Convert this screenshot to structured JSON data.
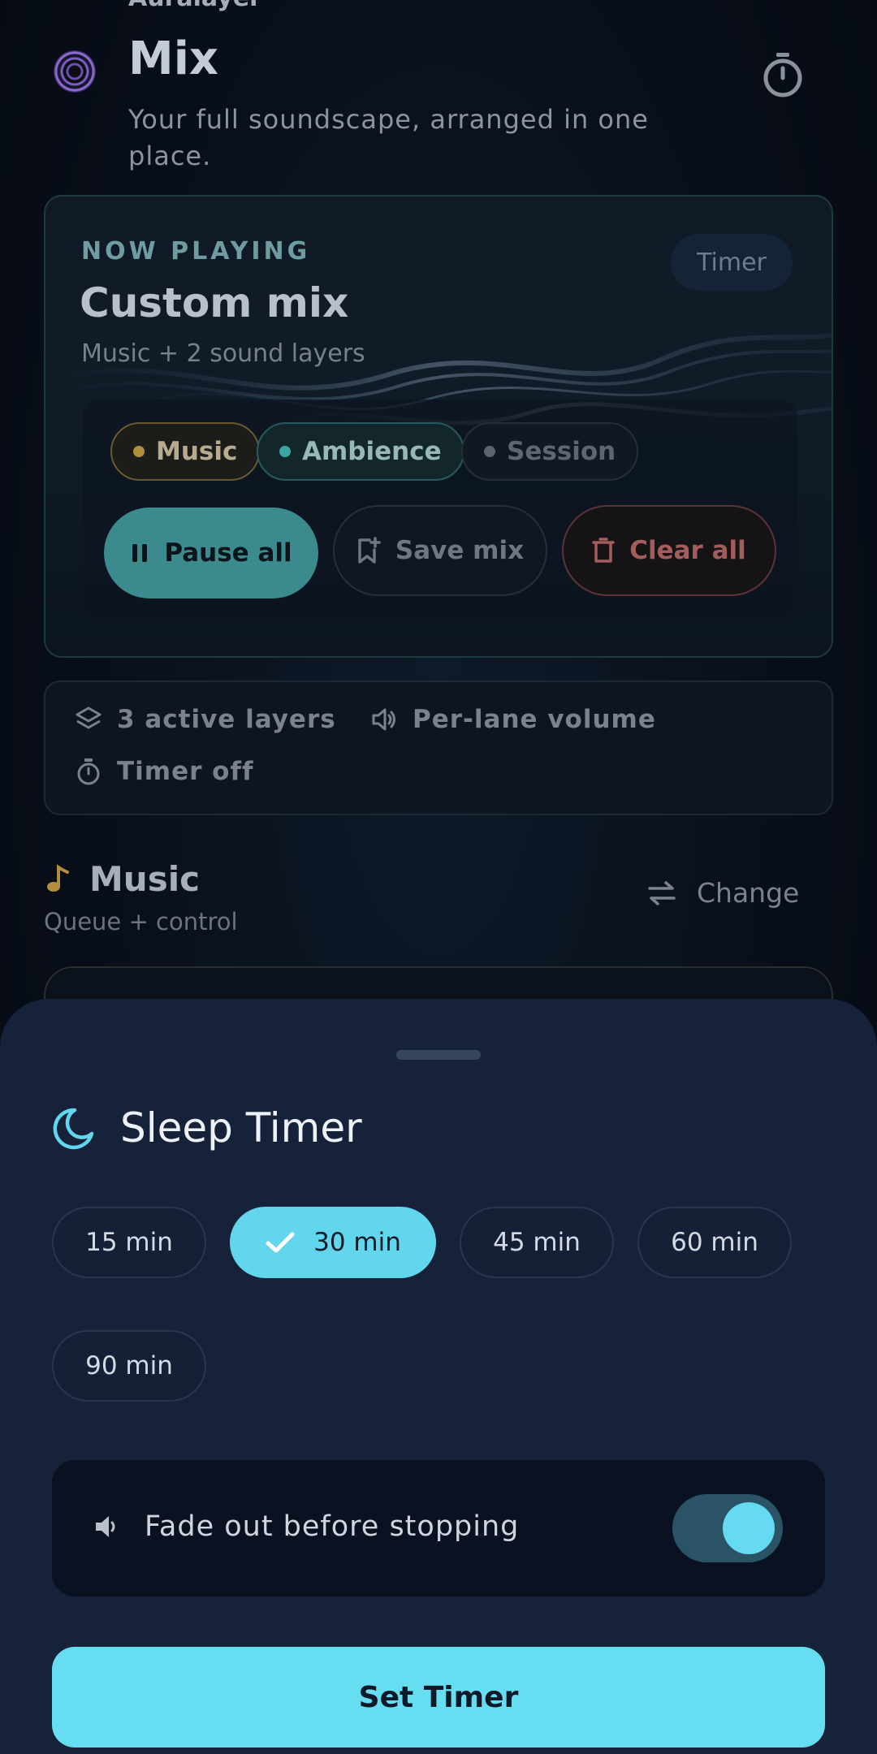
{
  "header": {
    "app_name": "Auralayer",
    "title": "Mix",
    "subtitle": "Your full soundscape, arranged in one place."
  },
  "now_playing": {
    "label": "NOW PLAYING",
    "title": "Custom mix",
    "subtitle": "Music + 2 sound layers",
    "timer_pill": "Timer",
    "chips": [
      {
        "label": "Music",
        "color": "#b08e3e"
      },
      {
        "label": "Ambience",
        "color": "#3fa4a2"
      },
      {
        "label": "Session",
        "color": "#5a6470"
      }
    ],
    "actions": {
      "pause": "Pause all",
      "save": "Save mix",
      "clear": "Clear all"
    }
  },
  "stats": {
    "layers": "3 active layers",
    "volume": "Per-lane volume",
    "timer": "Timer off"
  },
  "music_section": {
    "title": "Music",
    "subtitle": "Queue + control",
    "change": "Change"
  },
  "sleep_sheet": {
    "title": "Sleep Timer",
    "durations": [
      "15 min",
      "30 min",
      "45 min",
      "60 min",
      "90 min"
    ],
    "selected": "30 min",
    "fade_label": "Fade out before stopping",
    "fade_enabled": true,
    "set_button": "Set Timer"
  },
  "colors": {
    "accent": "#66ddf0",
    "sheet_bg": "#16213a",
    "music": "#b08e3e",
    "ambience": "#3fa4a2",
    "danger": "#a45d5c"
  }
}
